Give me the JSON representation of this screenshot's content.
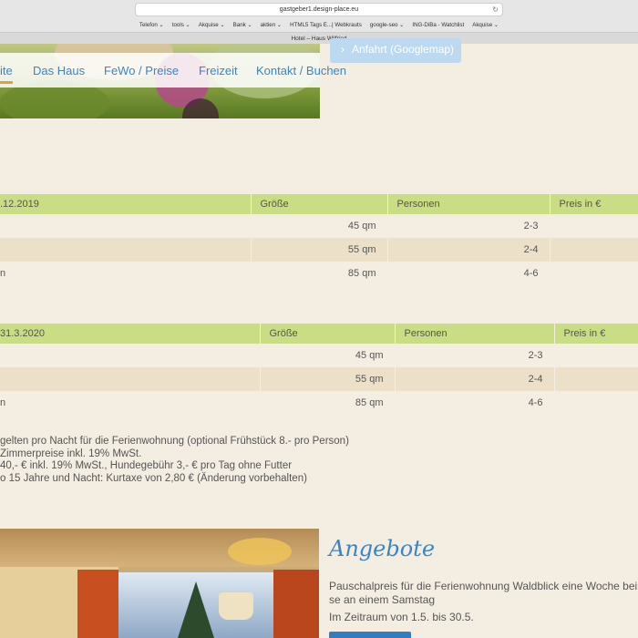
{
  "browser": {
    "url": "gastgeber1.design-place.eu",
    "bookmarks": [
      "Telefon ⌄",
      "tools ⌄",
      "Akquise ⌄",
      "Bank ⌄",
      "aktien ⌄",
      "HTML5 Tags E...| Webkrauts",
      "google-seo ⌄",
      "ING-DiBa - Watchlist",
      "Akquise ⌄"
    ],
    "tab_title": "Hotel – Haus Wilfried",
    "reload_icon": "reload-icon"
  },
  "nav": {
    "items": [
      "ite",
      "Das Haus",
      "FeWo / Preise",
      "Freizeit",
      "Kontakt / Buchen"
    ],
    "active_color": "#e0a03a",
    "map_button": "Anfahrt (Googlemap)",
    "map_icon": "chevron-right-icon"
  },
  "table1": {
    "headers": [
      ".12.2019",
      "Größe",
      "Personen",
      "Preis in €"
    ],
    "rows": [
      [
        "",
        "45 qm",
        "2-3",
        ""
      ],
      [
        "",
        "55 qm",
        "2-4",
        ""
      ],
      [
        "n",
        "85 qm",
        "4-6",
        ""
      ]
    ]
  },
  "table2": {
    "headers": [
      "31.3.2020",
      "Größe",
      "Personen",
      "Preis in €"
    ],
    "rows": [
      [
        "",
        "45 qm",
        "2-3",
        ""
      ],
      [
        "",
        "55 qm",
        "2-4",
        ""
      ],
      [
        "n",
        "85 qm",
        "4-6",
        ""
      ]
    ]
  },
  "notes": [
    "gelten pro Nacht für die Ferienwohnung (optional Frühstück 8.- pro Person)",
    "Zimmerpreise inkl. 19% MwSt.",
    "40,- € inkl. 19% MwSt., Hundegebühr 3,- € pro Tag ohne Futter",
    "o 15 Jahre und Nacht: Kurtaxe von 2,80 € (Änderung vorbehalten)"
  ],
  "angebote": {
    "title": "Angebote",
    "line1": "Pauschalpreis für die Ferienwohnung Waldblick eine Woche bei",
    "line2": "se an einem Samstag",
    "line3": "Im Zeitraum von 1.5. bis 30.5."
  },
  "colors": {
    "background": "#f4ede2",
    "table_header": "#c9dd84",
    "table_alt_row": "#ece0c8",
    "link_blue": "#3a86c5"
  }
}
